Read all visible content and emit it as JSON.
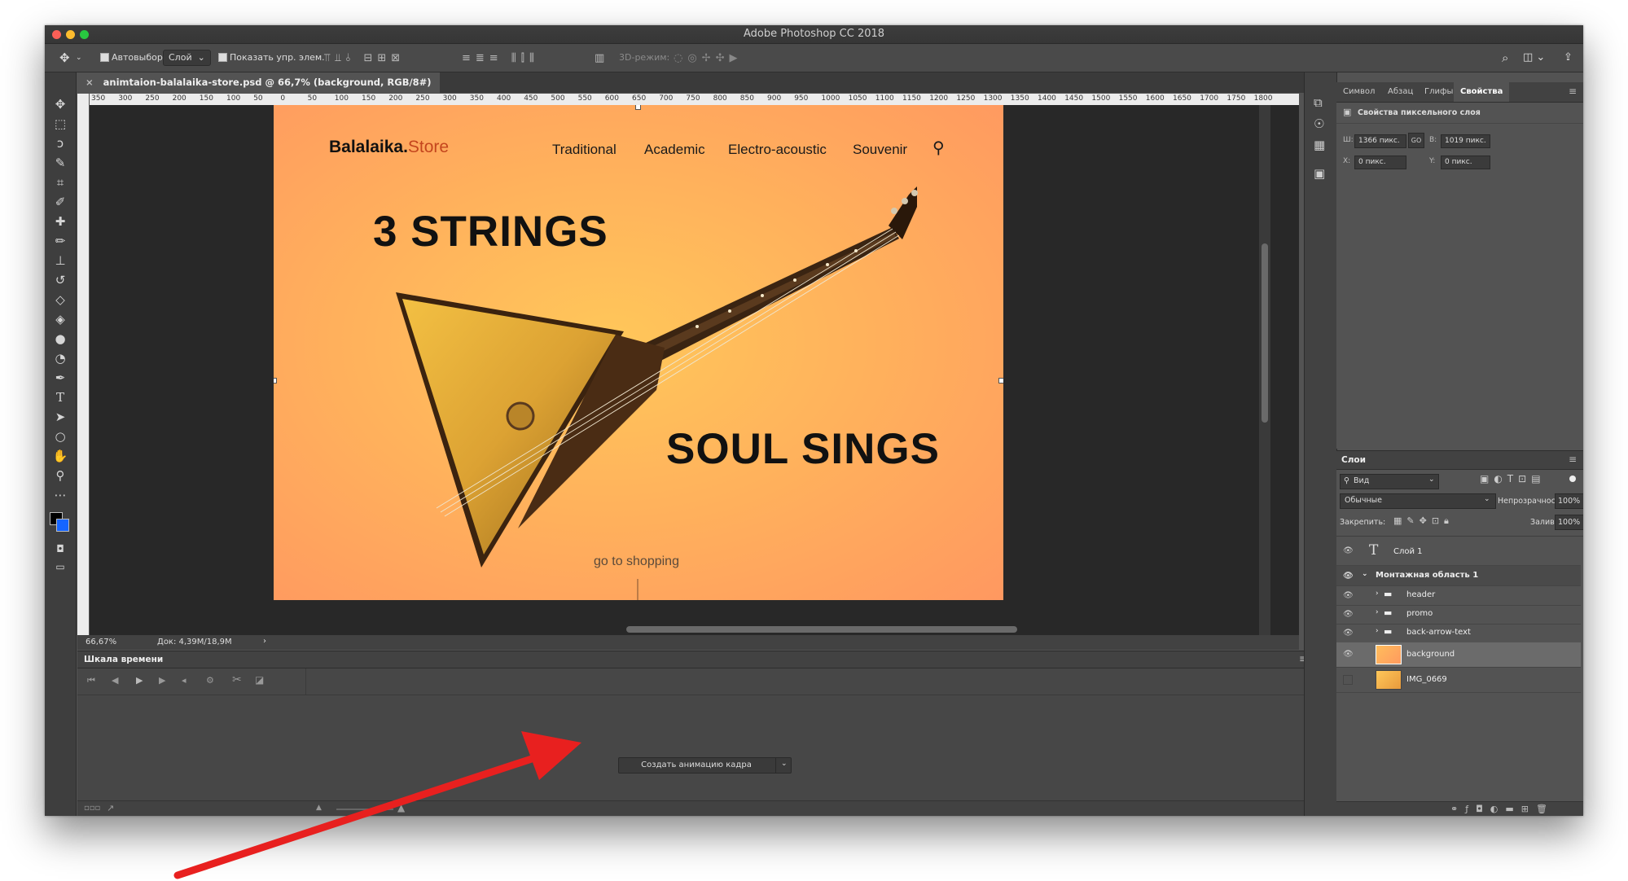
{
  "window": {
    "title": "Adobe Photoshop CC 2018"
  },
  "options_bar": {
    "autoselect_label": "Автовыбор:",
    "autoselect_value": "Слой",
    "show_controls_label": "Показать упр. элем.",
    "mode_3d_label": "3D-режим:"
  },
  "document_tab": {
    "title": "animtaion-balalaika-store.psd @ 66,7% (background, RGB/8#)"
  },
  "ruler_ticks": [
    "350",
    "300",
    "250",
    "200",
    "150",
    "100",
    "50",
    "0",
    "50",
    "100",
    "150",
    "200",
    "250",
    "300",
    "350",
    "400",
    "450",
    "500",
    "550",
    "600",
    "650",
    "700",
    "750",
    "800",
    "850",
    "900",
    "950",
    "1000",
    "1050",
    "1100",
    "1150",
    "1200",
    "1250",
    "1300",
    "1350",
    "1400",
    "1450",
    "1500",
    "1550",
    "1600",
    "1650",
    "1700",
    "1750",
    "1800"
  ],
  "artboard": {
    "logo_main": "Balalaika.",
    "logo_accent": "Store",
    "nav": [
      "Traditional",
      "Academic",
      "Electro-acoustic",
      "Souvenir"
    ],
    "headline_top": "3 STRINGS",
    "headline_bottom": "SOUL SINGS",
    "cta": "go to shopping"
  },
  "status_bar": {
    "zoom": "66,67%",
    "doc_info": "Док: 4,39M/18,9M"
  },
  "timeline": {
    "title": "Шкала времени",
    "create_button": "Создать анимацию кадра"
  },
  "properties_panel": {
    "tabs": [
      "Символ",
      "Абзац",
      "Глифы",
      "Свойства"
    ],
    "active_tab": "Свойства",
    "header": "Свойства пиксельного слоя",
    "w_label": "Ш:",
    "w_value": "1366 пикс.",
    "h_label": "В:",
    "h_value": "1019 пикс.",
    "x_label": "X:",
    "x_value": "0 пикс.",
    "y_label": "Y:",
    "y_value": "0 пикс.",
    "link_label": "GO"
  },
  "layers_panel": {
    "title": "Слои",
    "filter_label": "Вид",
    "blend_mode": "Обычные",
    "opacity_label": "Непрозрачность:",
    "opacity_value": "100%",
    "lock_label": "Закрепить:",
    "fill_label": "Заливка:",
    "fill_value": "100%",
    "layers": [
      {
        "name": "Слой 1",
        "type": "text",
        "visible": true
      },
      {
        "name": "Монтажная область 1",
        "type": "artboard",
        "visible": true
      },
      {
        "name": "header",
        "type": "group",
        "visible": true
      },
      {
        "name": "promo",
        "type": "group",
        "visible": true
      },
      {
        "name": "back-arrow-text",
        "type": "group",
        "visible": true
      },
      {
        "name": "background",
        "type": "pixel",
        "visible": true,
        "selected": true
      },
      {
        "name": "IMG_0669",
        "type": "smart-object",
        "visible": false
      }
    ]
  },
  "colors": {
    "ui_bg": "#535353",
    "ui_dark": "#3e3e3e",
    "canvas_dark": "#282828",
    "artboard_orange": "#ff9e5f",
    "artboard_yellow": "#ffc75a",
    "logo_accent": "#c4461e",
    "annotation_arrow": "#e8201f",
    "fg_color": "#000000",
    "bg_color": "#1565ff"
  }
}
